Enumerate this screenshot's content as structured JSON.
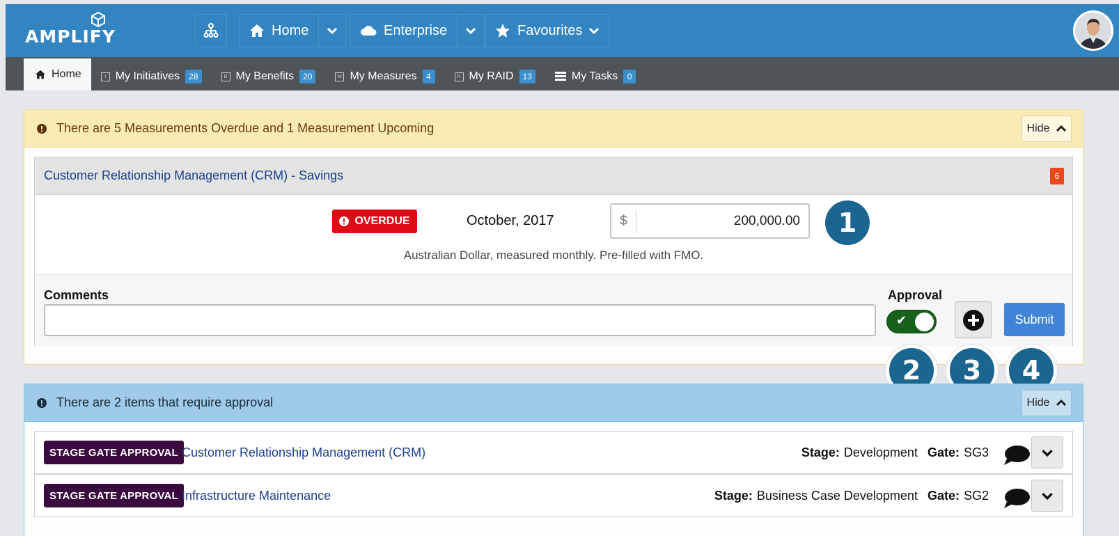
{
  "app": {
    "logo_text": "AMPLIFY"
  },
  "topnav": {
    "home_label": "Home",
    "enterprise_label": "Enterprise",
    "favourites_label": "Favourites"
  },
  "tabs": [
    {
      "label": "Home",
      "count": null,
      "icon": "home-icon",
      "box_letter": ""
    },
    {
      "label": "My Initiatives",
      "count": "28",
      "icon": "initiative-icon",
      "box_letter": "I"
    },
    {
      "label": "My Benefits",
      "count": "20",
      "icon": "benefit-icon",
      "box_letter": "B"
    },
    {
      "label": "My Measures",
      "count": "4",
      "icon": "measure-icon",
      "box_letter": "M"
    },
    {
      "label": "My RAID",
      "count": "13",
      "icon": "raid-icon",
      "box_letter": "R"
    },
    {
      "label": "My Tasks",
      "count": "0",
      "icon": "tasks-icon",
      "box_letter": ""
    }
  ],
  "measurement_alert": {
    "message": "There are 5 Measurements Overdue and 1 Measurement Upcoming",
    "hide_label": "Hide",
    "card": {
      "title": "Customer Relationship Management (CRM) - Savings",
      "count": "6",
      "status": "OVERDUE",
      "period": "October, 2017",
      "currency_symbol": "$",
      "amount": "200,000.00",
      "note": "Australian Dollar, measured monthly. Pre-filled with FMO.",
      "comments_label": "Comments",
      "comments_value": "",
      "approval_label": "Approval",
      "approval_on": true,
      "submit_label": "Submit"
    }
  },
  "callouts": [
    "1",
    "2",
    "3",
    "4"
  ],
  "approval_alert": {
    "message": "There are 2 items that require approval",
    "hide_label": "Hide",
    "stage_key": "Stage:",
    "gate_key": "Gate:",
    "items": [
      {
        "badge": "STAGE GATE APPROVAL",
        "title": "Customer Relationship Management (CRM)",
        "stage": "Development",
        "gate": "SG3"
      },
      {
        "badge": "STAGE GATE APPROVAL",
        "title": "Infrastructure Maintenance",
        "stage": "Business Case Development",
        "gate": "SG2"
      }
    ]
  },
  "colors": {
    "topbar": "#3385c2",
    "tabbar": "#4f5459",
    "overdue": "#dd0b13",
    "submit": "#3f84d6",
    "stage_gate_badge": "#3b0a3e",
    "callout": "#1b6591"
  }
}
